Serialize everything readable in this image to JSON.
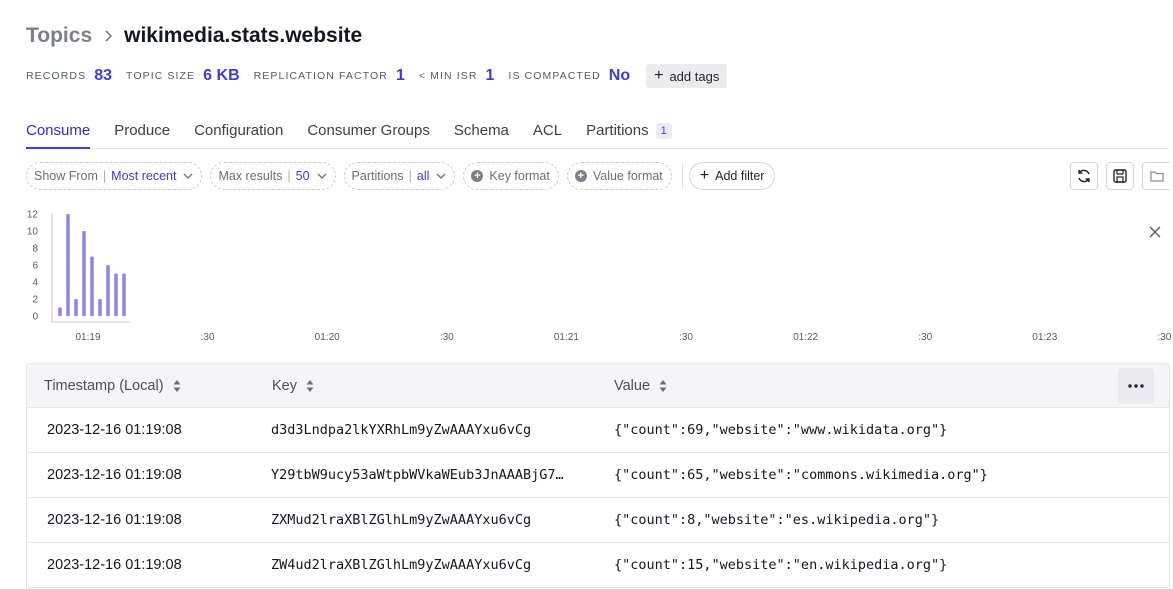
{
  "breadcrumb": {
    "root": "Topics",
    "title": "wikimedia.stats.website"
  },
  "stats": [
    {
      "label": "RECORDS",
      "value": "83"
    },
    {
      "label": "TOPIC SIZE",
      "value": "6 KB"
    },
    {
      "label": "REPLICATION FACTOR",
      "value": "1"
    },
    {
      "label": "< MIN ISR",
      "value": "1"
    },
    {
      "label": "IS COMPACTED",
      "value": "No"
    }
  ],
  "add_tags_label": "add tags",
  "tabs": [
    {
      "label": "Consume",
      "active": true
    },
    {
      "label": "Produce"
    },
    {
      "label": "Configuration"
    },
    {
      "label": "Consumer Groups"
    },
    {
      "label": "Schema"
    },
    {
      "label": "ACL"
    },
    {
      "label": "Partitions",
      "count": "1"
    }
  ],
  "filters": {
    "show_from": {
      "label": "Show From",
      "value": "Most recent"
    },
    "max_results": {
      "label": "Max results",
      "value": "50"
    },
    "partitions": {
      "label": "Partitions",
      "value": "all"
    },
    "key_format": "Key format",
    "value_format": "Value format",
    "add_filter": "Add filter"
  },
  "chart_data": {
    "type": "bar",
    "y_ticks": [
      "0",
      "2",
      "4",
      "6",
      "8",
      "10",
      "12"
    ],
    "ylim": [
      0,
      12
    ],
    "x_ticks": [
      "01:19",
      ":30",
      "01:20",
      ":30",
      "01:21",
      ":30",
      "01:22",
      ":30",
      "01:23",
      ":30"
    ],
    "values": [
      1,
      12,
      2,
      10,
      7,
      2,
      6,
      5,
      5
    ],
    "color": "#8b86ee"
  },
  "table": {
    "columns": [
      "Timestamp (Local)",
      "Key",
      "Value"
    ],
    "rows": [
      {
        "ts": "2023-12-16 01:19:08",
        "key": "d3d3Lndpa2lkYXRhLm9yZwAAAYxu6vCg",
        "value": "{\"count\":69,\"website\":\"www.wikidata.org\"}"
      },
      {
        "ts": "2023-12-16 01:19:08",
        "key": "Y29tbW9ucy53aWtpbWVkaWEub3JnAAABjG7…",
        "value": "{\"count\":65,\"website\":\"commons.wikimedia.org\"}"
      },
      {
        "ts": "2023-12-16 01:19:08",
        "key": "ZXMud2lraXBlZGlhLm9yZwAAAYxu6vCg",
        "value": "{\"count\":8,\"website\":\"es.wikipedia.org\"}"
      },
      {
        "ts": "2023-12-16 01:19:08",
        "key": "ZW4ud2lraXBlZGlhLm9yZwAAAYxu6vCg",
        "value": "{\"count\":15,\"website\":\"en.wikipedia.org\"}"
      }
    ]
  },
  "colors": {
    "accent": "#3e3be0",
    "bar": "#8b86ee"
  }
}
